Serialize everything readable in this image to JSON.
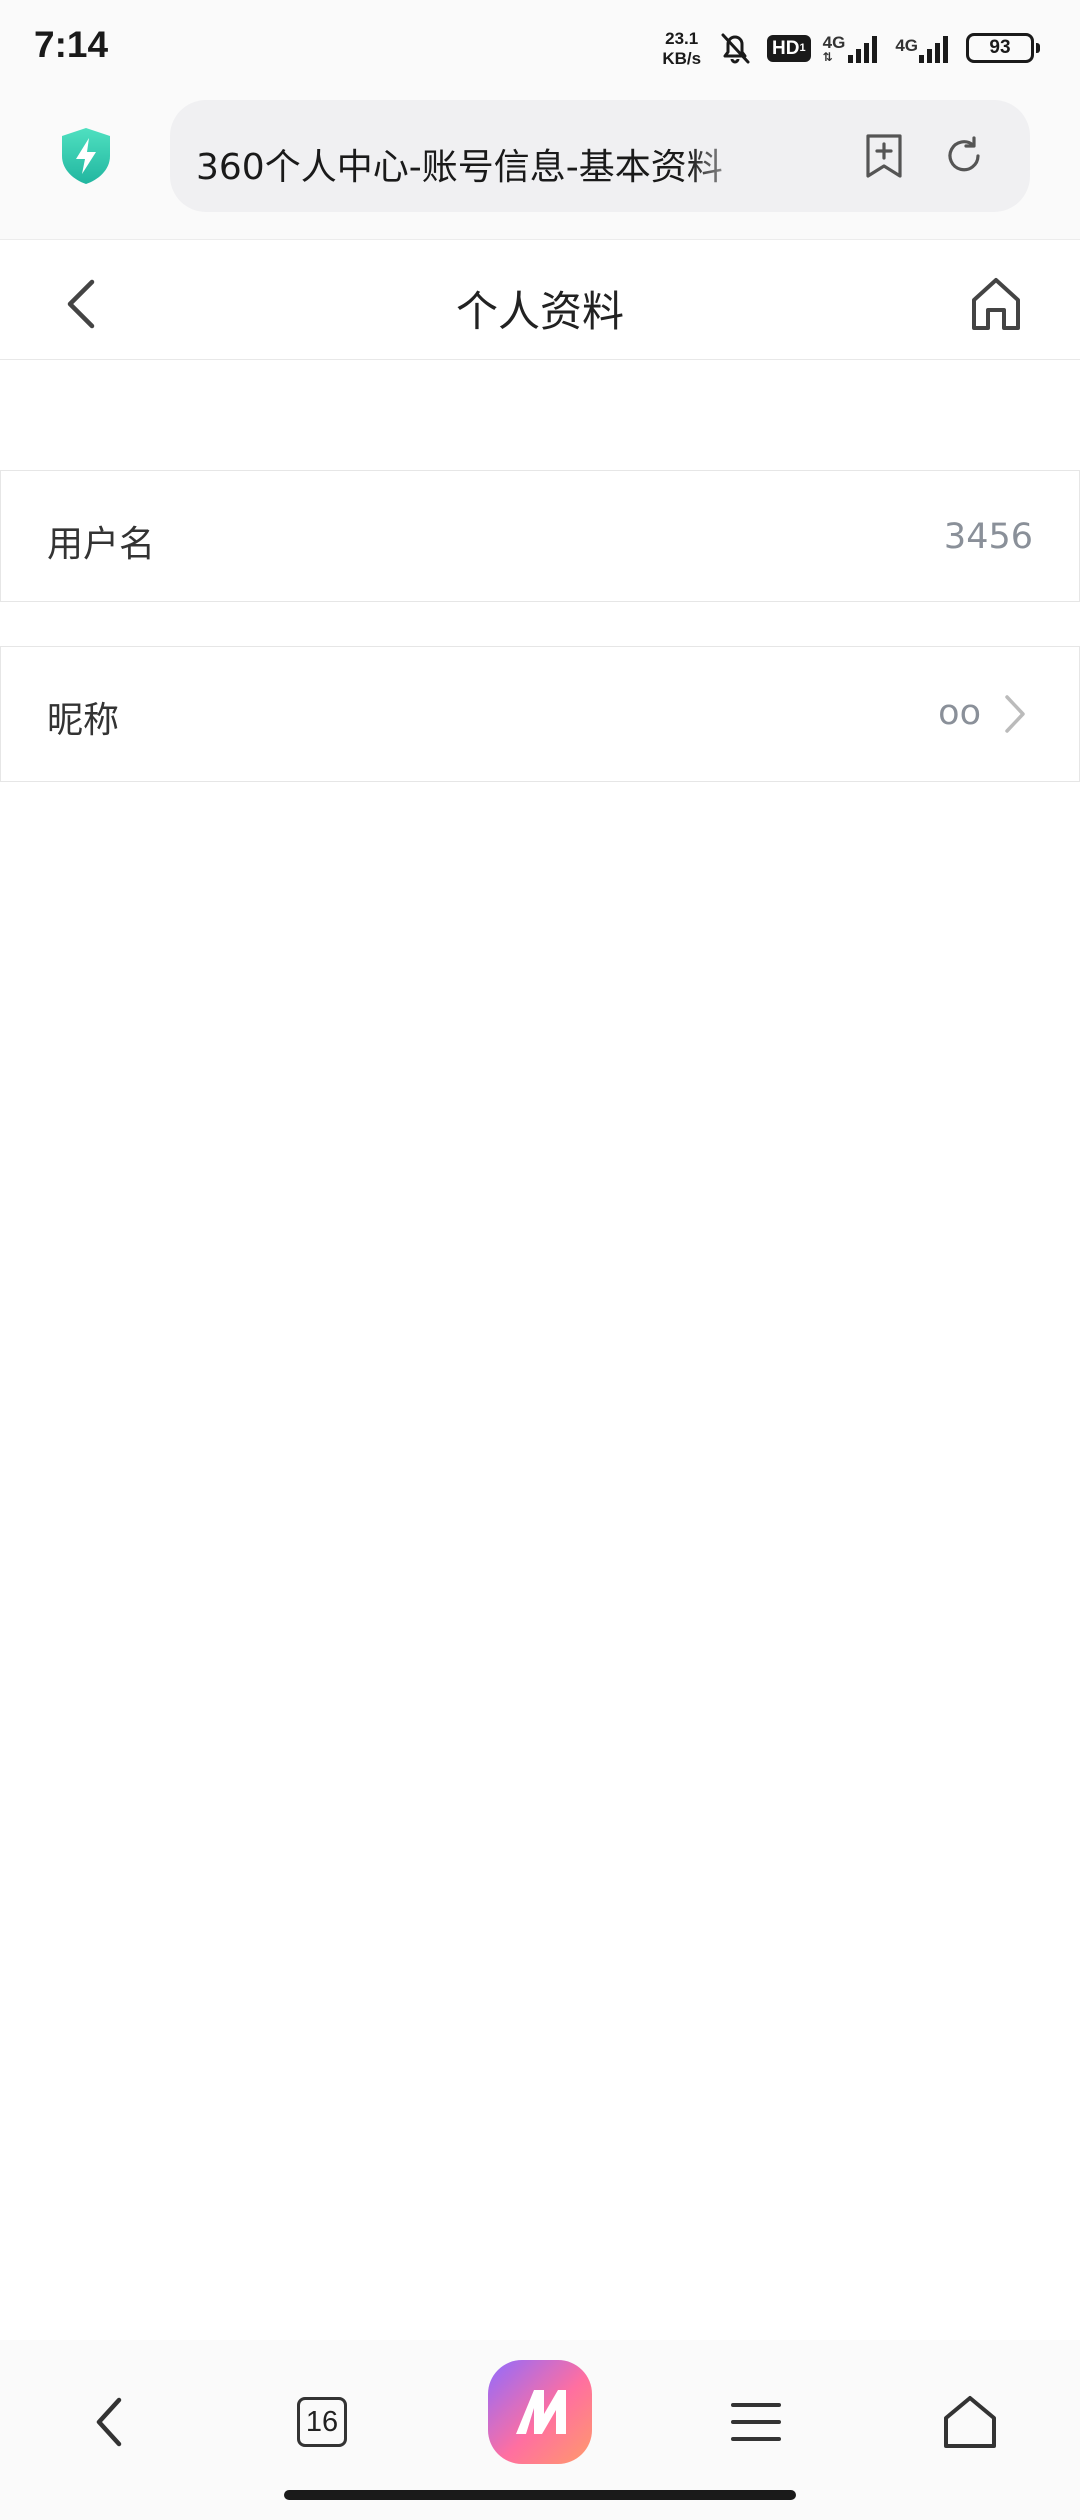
{
  "status_bar": {
    "time": "7:14",
    "net_speed_value": "23.1",
    "net_speed_unit": "KB/s",
    "hd_label": "HD",
    "sim1_network": "4G",
    "sim2_network": "4G",
    "battery": "93"
  },
  "browser": {
    "url_title": "360个人中心-账号信息-基本资料",
    "security_icon": "shield-bolt-icon",
    "accent_color": "#3ad0b0"
  },
  "header": {
    "title": "个人资料"
  },
  "rows": [
    {
      "label": "用户名",
      "value": "3456",
      "has_arrow": false
    },
    {
      "label": "昵称",
      "value": "oo",
      "has_arrow": true
    }
  ],
  "toolbar": {
    "tab_count": "16",
    "ai_gradient": [
      "#9b6bff",
      "#ff6fa0",
      "#ff9a6a"
    ]
  }
}
